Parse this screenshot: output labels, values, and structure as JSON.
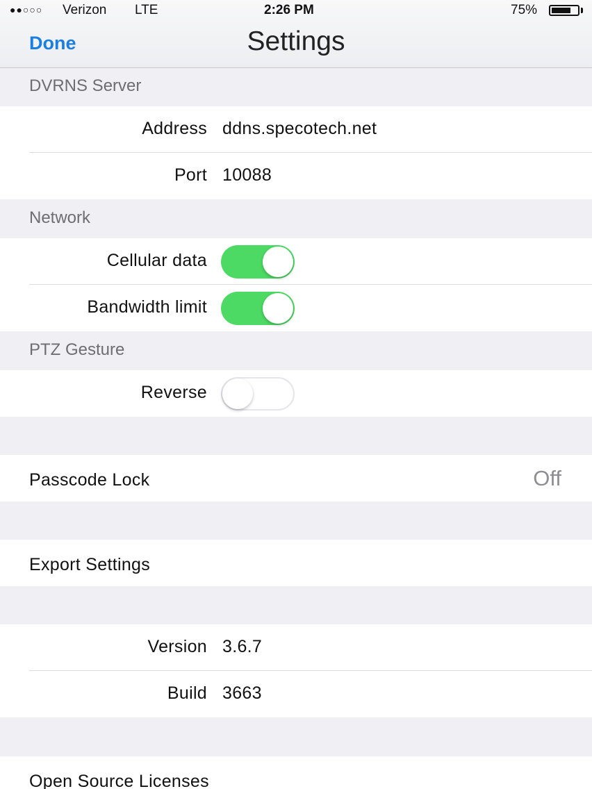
{
  "status_bar": {
    "signal": "●●○○○",
    "carrier": "Verizon",
    "network": "LTE",
    "time": "2:26 PM",
    "battery": "75%",
    "battery_level": 0.75
  },
  "nav": {
    "done_label": "Done",
    "title": "Settings"
  },
  "sections": {
    "dvrns": {
      "header": "DVRNS Server",
      "address_label": "Address",
      "address_value": "ddns.specotech.net",
      "port_label": "Port",
      "port_value": "10088"
    },
    "network": {
      "header": "Network",
      "cellular_label": "Cellular data",
      "cellular_on": true,
      "bandwidth_label": "Bandwidth limit",
      "bandwidth_on": true
    },
    "ptz": {
      "header": "PTZ Gesture",
      "reverse_label": "Reverse",
      "reverse_on": false
    },
    "passcode": {
      "label": "Passcode Lock",
      "value": "Off"
    },
    "export": {
      "label": "Export Settings"
    },
    "about": {
      "version_label": "Version",
      "version_value": "3.6.7",
      "build_label": "Build",
      "build_value": "3663"
    },
    "licenses": {
      "label": "Open Source Licenses"
    }
  },
  "colors": {
    "accent": "#1a7fe0",
    "toggle_on": "#4cd964",
    "group_background": "#efeff4"
  }
}
